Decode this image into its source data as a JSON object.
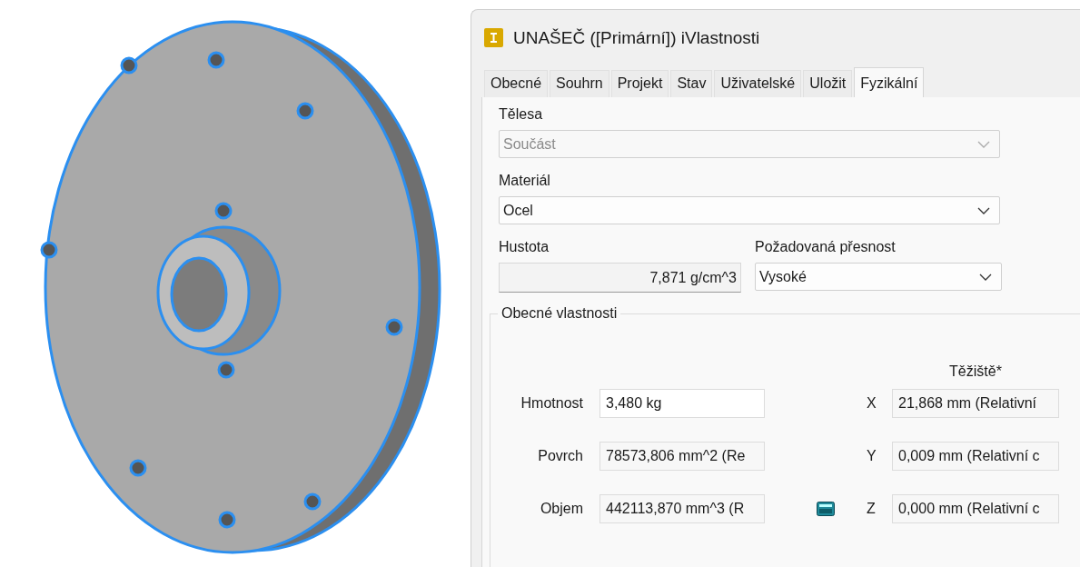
{
  "window": {
    "title": "UNAŠEČ ([Primární]) iVlastnosti"
  },
  "tabs": [
    {
      "label": "Obecné",
      "selected": false
    },
    {
      "label": "Souhrn",
      "selected": false
    },
    {
      "label": "Projekt",
      "selected": false
    },
    {
      "label": "Stav",
      "selected": false
    },
    {
      "label": "Uživatelské",
      "selected": false
    },
    {
      "label": "Uložit",
      "selected": false
    },
    {
      "label": "Fyzikální",
      "selected": true
    }
  ],
  "bodies": {
    "label": "Tělesa",
    "value": "Součást",
    "disabled": true
  },
  "material": {
    "label": "Materiál",
    "value": "Ocel",
    "disabled": false
  },
  "density": {
    "label": "Hustota",
    "value": "7,871 g/cm^3"
  },
  "accuracy": {
    "label": "Požadovaná přesnost",
    "value": "Vysoké"
  },
  "general_properties": {
    "title": "Obecné vlastnosti",
    "center_of_gravity_heading": "Těžiště*",
    "rows": [
      {
        "label": "Hmotnost",
        "value": "3,480 kg",
        "axis": "X",
        "axis_value": "21,868 mm (Relativní",
        "calculator": false
      },
      {
        "label": "Povrch",
        "value": "78573,806 mm^2 (Re",
        "axis": "Y",
        "axis_value": "0,009 mm (Relativní c",
        "calculator": false
      },
      {
        "label": "Objem",
        "value": "442113,870 mm^3 (R",
        "axis": "Z",
        "axis_value": "0,000 mm (Relativní c",
        "calculator": true
      }
    ]
  }
}
